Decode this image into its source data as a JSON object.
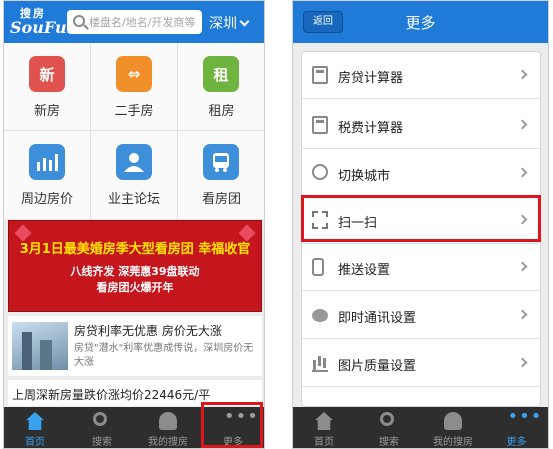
{
  "left": {
    "logo_top": "搜房",
    "logo_bottom": "SouFun",
    "search_placeholder": "楼盘名/地名/开发商等",
    "city": "深圳",
    "grid": [
      {
        "label": "新房",
        "icon_char": "新",
        "icon": "new-house-icon",
        "color": "#e0524e"
      },
      {
        "label": "二手房",
        "icon_char": "⇔",
        "icon": "second-hand-house-icon",
        "color": "#f08f2a"
      },
      {
        "label": "租房",
        "icon_char": "租",
        "icon": "rent-house-icon",
        "color": "#6fb43f"
      },
      {
        "label": "周边房价",
        "icon_char": "",
        "icon": "nearby-price-chart-icon",
        "color": "#3d8fd9"
      },
      {
        "label": "业主论坛",
        "icon_char": "",
        "icon": "owner-forum-icon",
        "color": "#3d8fd9"
      },
      {
        "label": "看房团",
        "icon_char": "",
        "icon": "viewing-bus-icon",
        "color": "#3d8fd9"
      }
    ],
    "banner": {
      "line1": "3月1日最美婚房季大型看房团 幸福收官",
      "line2": "八线齐发  深莞惠39盘联动",
      "line3": "看房团火爆开年"
    },
    "news": {
      "title": "房贷利率无优惠 房价无大涨",
      "desc": "房贷\"潜水\"利率优惠成传说，深圳房价无大涨"
    },
    "news2": "上周深新房量跌价涨均价22446元/平",
    "tabs": [
      {
        "label": "首页",
        "icon": "home-icon"
      },
      {
        "label": "搜索",
        "icon": "search-icon"
      },
      {
        "label": "我的搜房",
        "icon": "user-icon"
      },
      {
        "label": "更多",
        "icon": "more-icon"
      }
    ]
  },
  "right": {
    "back": "返回",
    "title": "更多",
    "items": [
      {
        "label": "房贷计算器",
        "icon": "calculator-icon"
      },
      {
        "label": "税费计算器",
        "icon": "calculator-icon"
      },
      {
        "label": "切换城市",
        "icon": "switch-city-icon"
      },
      {
        "label": "扫一扫",
        "icon": "qr-scan-icon"
      },
      {
        "label": "推送设置",
        "icon": "phone-icon"
      },
      {
        "label": "即时通讯设置",
        "icon": "chat-icon"
      },
      {
        "label": "图片质量设置",
        "icon": "image-quality-icon"
      }
    ],
    "tabs": [
      {
        "label": "首页",
        "icon": "home-icon"
      },
      {
        "label": "搜索",
        "icon": "search-icon"
      },
      {
        "label": "我的搜房",
        "icon": "user-icon"
      },
      {
        "label": "更多",
        "icon": "more-icon"
      }
    ]
  },
  "colors": {
    "primary": "#1f7ad8",
    "tabbar": "#2e2e2e",
    "active_tab": "#3aa0f0",
    "highlight": "#e0141b"
  }
}
